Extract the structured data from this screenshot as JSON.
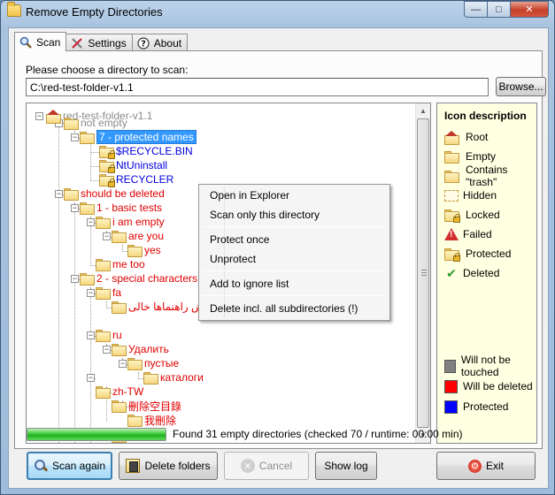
{
  "window": {
    "title": "Remove Empty Directories",
    "minimize_glyph": "—",
    "maximize_glyph": "□",
    "close_glyph": "✕"
  },
  "tabs": [
    {
      "label": "Scan",
      "icon": "magnifier-icon"
    },
    {
      "label": "Settings",
      "icon": "tools-icon"
    },
    {
      "label": "About",
      "icon": "help-icon"
    }
  ],
  "scan": {
    "choose_label": "Please choose a directory to scan:",
    "directory_value": "C:\\red-test-folder-v1.1",
    "browse_label": "Browse..."
  },
  "tree": [
    {
      "label": "red-test-folder-v1.1",
      "color": "gray",
      "icon": "root"
    },
    {
      "label": "not empty",
      "color": "gray",
      "icon": "folder"
    },
    {
      "label": "7 - protected names",
      "color": "selected",
      "icon": "folder"
    },
    {
      "label": "$RECYCLE.BIN",
      "color": "blue",
      "icon": "locked"
    },
    {
      "label": "NtUninstall",
      "color": "blue",
      "icon": "locked"
    },
    {
      "label": "RECYCLER",
      "color": "blue",
      "icon": "locked"
    },
    {
      "label": "should be deleted",
      "color": "red",
      "icon": "folder"
    },
    {
      "label": "1 - basic tests",
      "color": "red",
      "icon": "folder"
    },
    {
      "label": "i am empty",
      "color": "red",
      "icon": "folder"
    },
    {
      "label": "are you",
      "color": "red",
      "icon": "folder"
    },
    {
      "label": "yes",
      "color": "red",
      "icon": "folder"
    },
    {
      "label": "me too",
      "color": "red",
      "icon": "folder"
    },
    {
      "label": "2 - special characters",
      "color": "red",
      "icon": "folder"
    },
    {
      "label": "fa",
      "color": "red",
      "icon": "folder"
    },
    {
      "label": "گزارش راهنماها خالی",
      "color": "red",
      "icon": "folder"
    },
    {
      "label": "ru",
      "color": "red",
      "icon": "folder"
    },
    {
      "label": "Удалить",
      "color": "red",
      "icon": "folder"
    },
    {
      "label": "пустые",
      "color": "red",
      "icon": "folder"
    },
    {
      "label": "каталоги",
      "color": "red",
      "icon": "folder"
    },
    {
      "label": "zh-TW",
      "color": "red",
      "icon": "folder"
    },
    {
      "label": "刪除空目錄",
      "color": "red",
      "icon": "folder"
    },
    {
      "label": "我刪除",
      "color": "red",
      "icon": "folder"
    }
  ],
  "context_menu": {
    "items": [
      "Open in Explorer",
      "Scan only this directory",
      "Protect once",
      "Unprotect",
      "Add to ignore list",
      "Delete incl. all subdirectories (!)"
    ]
  },
  "icon_description": {
    "title": "Icon description",
    "items": [
      {
        "label": "Root",
        "icon": "root-icon"
      },
      {
        "label": "Empty",
        "icon": "folder-icon"
      },
      {
        "label": "Contains \"trash\"",
        "icon": "trash-folder-icon"
      },
      {
        "label": "Hidden",
        "icon": "hidden-folder-icon"
      },
      {
        "label": "Locked",
        "icon": "locked-folder-icon"
      },
      {
        "label": "Failed",
        "icon": "warning-icon"
      },
      {
        "label": "Protected",
        "icon": "protected-folder-icon"
      },
      {
        "label": "Deleted",
        "icon": "checkmark-icon"
      }
    ],
    "legend": [
      {
        "label": "Will not be touched",
        "color": "#808080"
      },
      {
        "label": "Will be deleted",
        "color": "#ff0000"
      },
      {
        "label": "Protected",
        "color": "#0000ff"
      }
    ]
  },
  "status": {
    "progress_percent": 100,
    "text": "Found 31 empty directories (checked 70 / runtime: 00:00 min)"
  },
  "buttons": {
    "scan_again": "Scan again",
    "delete_folders": "Delete folders",
    "cancel": "Cancel",
    "show_log": "Show log",
    "exit": "Exit"
  }
}
